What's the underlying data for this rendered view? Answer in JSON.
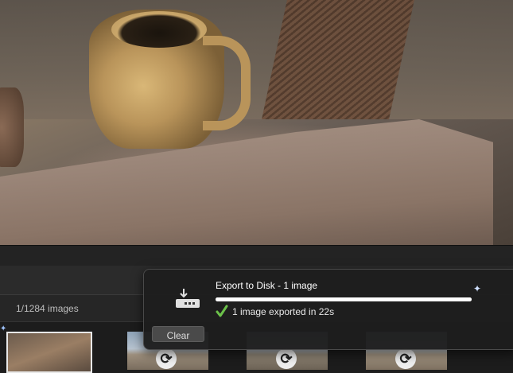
{
  "viewer": {
    "image_count": "1/1284 images"
  },
  "export_popover": {
    "title": "Export to Disk - 1 image",
    "progress_percent": 100,
    "status": "1 image exported in 22s",
    "clear_label": "Clear",
    "icons": {
      "download": "download-to-disk-icon",
      "check": "check-icon",
      "sparkle": "sparkle-icon"
    }
  },
  "filmstrip": {
    "sync_glyph": "⟳"
  },
  "colors": {
    "popover_bg": "#1e1e1e",
    "check_green": "#6cc24a",
    "progress": "#ffffff"
  }
}
